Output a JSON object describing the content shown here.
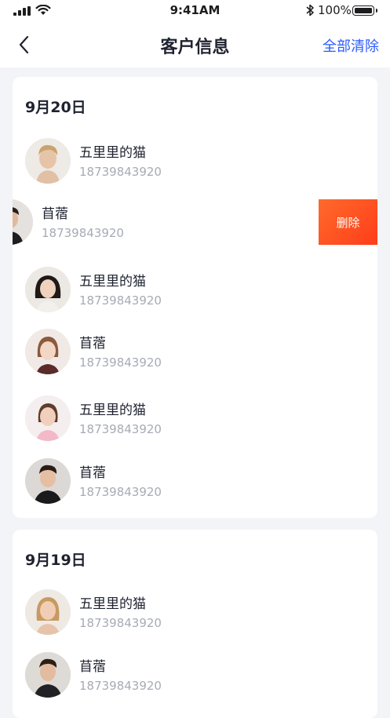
{
  "status_bar": {
    "time": "9:41AM",
    "battery": "100%"
  },
  "nav": {
    "title": "客户信息",
    "clear_label": "全部清除"
  },
  "groups": [
    {
      "date": "9月20日",
      "customers": [
        {
          "name": "五里里的猫",
          "phone": "18739843920"
        },
        {
          "name": "苜蓿",
          "phone": "18739843920",
          "action": "删除"
        },
        {
          "name": "五里里的猫",
          "phone": "18739843920"
        },
        {
          "name": "苜蓿",
          "phone": "18739843920"
        },
        {
          "name": "五里里的猫",
          "phone": "18739843920"
        },
        {
          "name": "苜蓿",
          "phone": "18739843920"
        }
      ]
    },
    {
      "date": "9月19日",
      "customers": [
        {
          "name": "五里里的猫",
          "phone": "18739843920"
        },
        {
          "name": "苜蓿",
          "phone": "18739843920"
        }
      ]
    }
  ],
  "colors": {
    "accent": "#2c5bff",
    "delete": "#ff4a20",
    "background": "#f3f4f8"
  }
}
